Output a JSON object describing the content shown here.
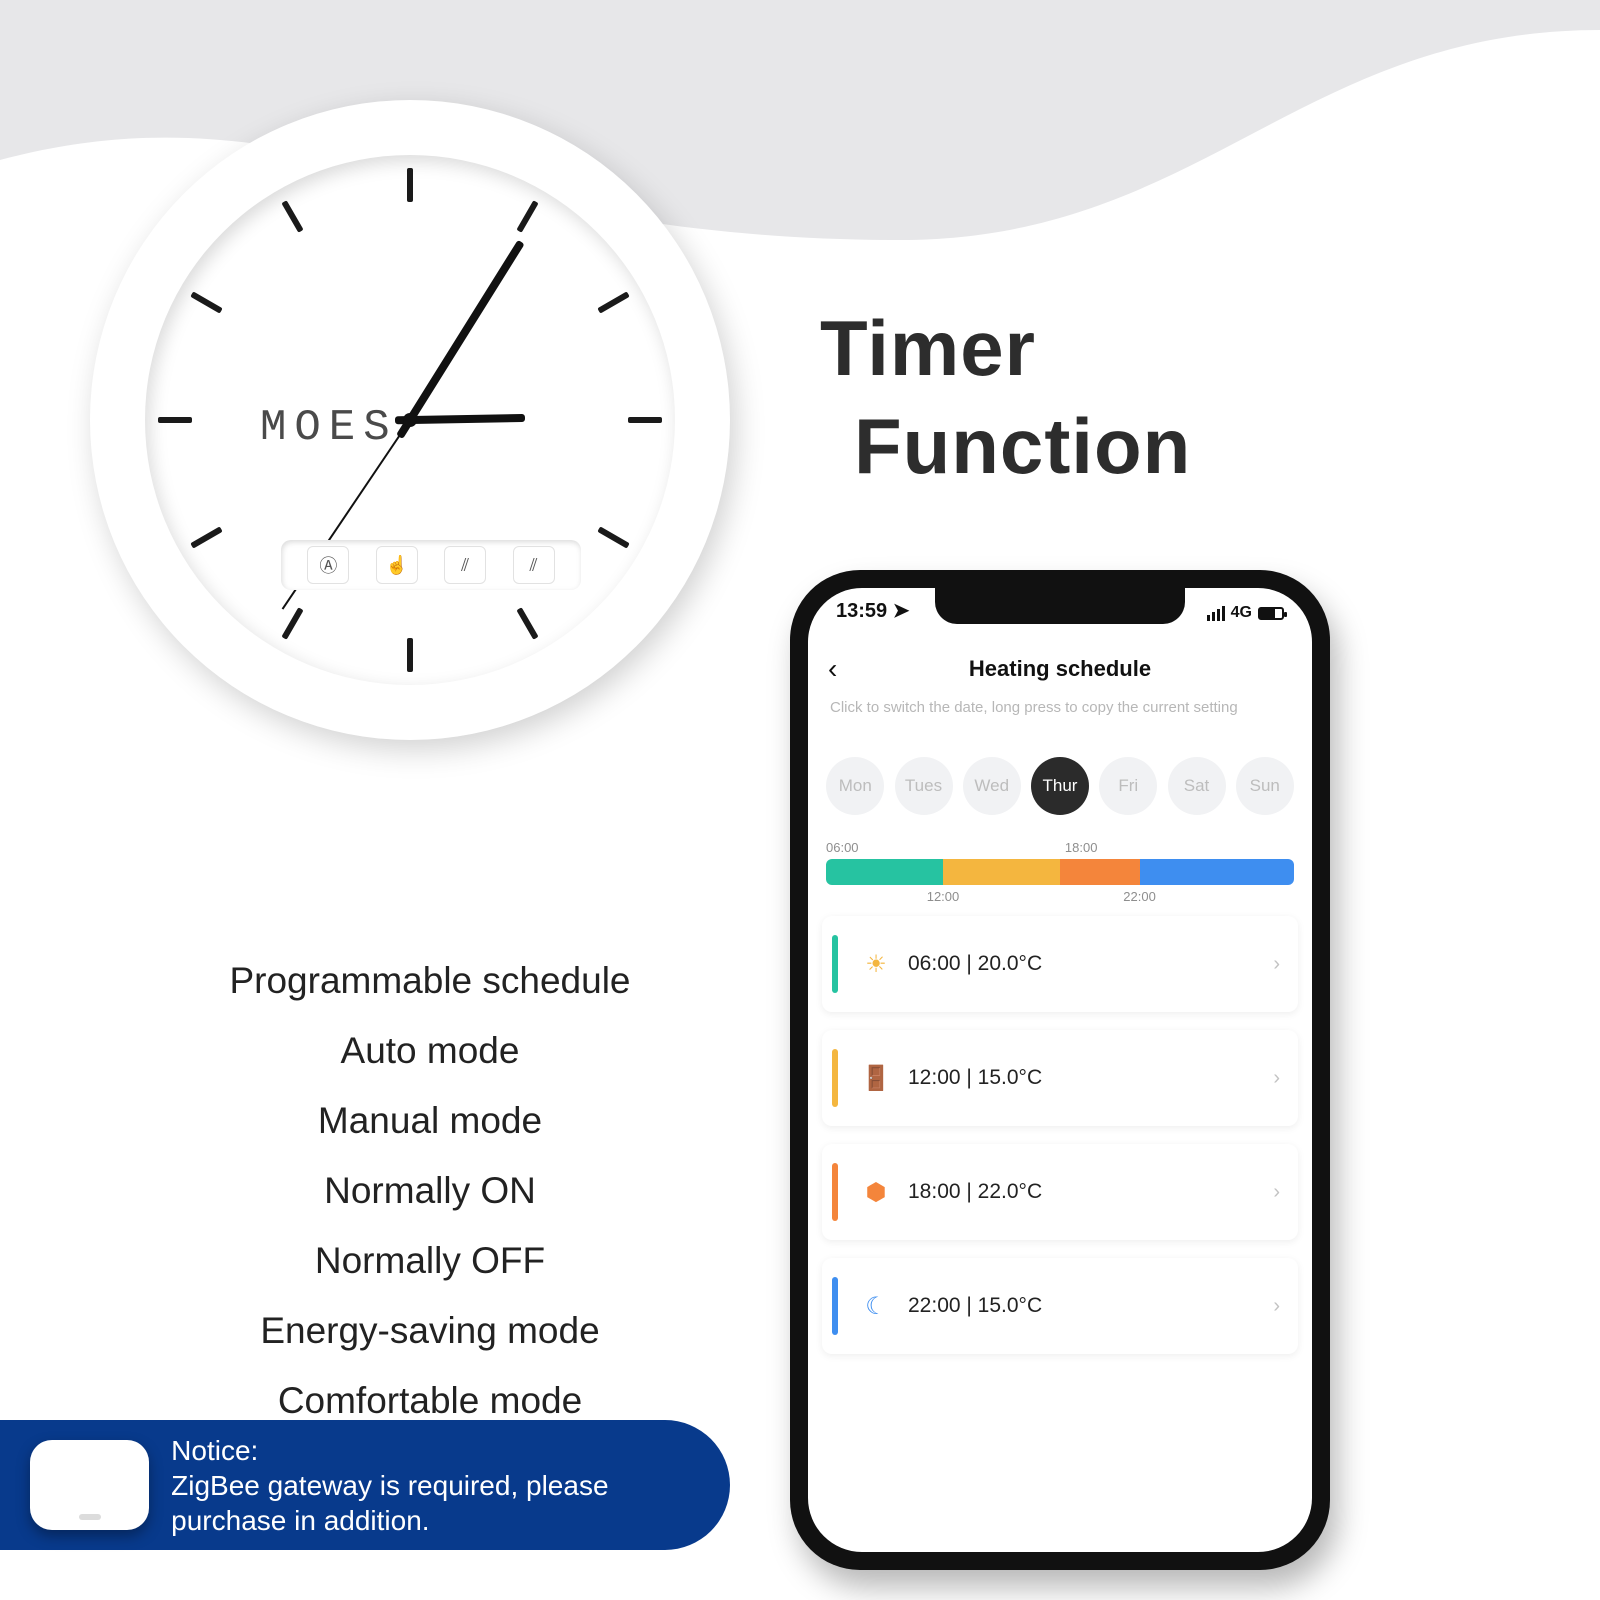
{
  "hero": {
    "line1": "Timer",
    "line2": "Function"
  },
  "clock": {
    "brand": "MOES"
  },
  "features": [
    "Programmable schedule",
    "Auto mode",
    "Manual mode",
    "Normally ON",
    "Normally OFF",
    "Energy-saving mode",
    "Comfortable mode"
  ],
  "notice": {
    "heading": "Notice:",
    "body": "ZigBee gateway is required, please purchase in addition."
  },
  "phone": {
    "status": {
      "time": "13:59",
      "network": "4G"
    },
    "title": "Heating schedule",
    "hint": "Click to switch the date, long press to copy the current setting",
    "days": [
      {
        "label": "Mon",
        "active": false
      },
      {
        "label": "Tues",
        "active": false
      },
      {
        "label": "Wed",
        "active": false
      },
      {
        "label": "Thur",
        "active": true
      },
      {
        "label": "Fri",
        "active": false
      },
      {
        "label": "Sat",
        "active": false
      },
      {
        "label": "Sun",
        "active": false
      }
    ],
    "timeline": {
      "top_left": "06:00",
      "top_right": "18:00",
      "bot_left": "12:00",
      "bot_right": "22:00",
      "segments": [
        {
          "color": "c-teal",
          "pct": 25
        },
        {
          "color": "c-amber",
          "pct": 25
        },
        {
          "color": "c-orange",
          "pct": 17
        },
        {
          "color": "c-blue",
          "pct": 33
        }
      ]
    },
    "rows": [
      {
        "stripe": "c-teal",
        "icon": "sun-icon",
        "icon_tone": "t-amber",
        "label": "06:00 | 20.0°C"
      },
      {
        "stripe": "c-amber",
        "icon": "door-icon",
        "icon_tone": "t-amber",
        "label": "12:00 | 15.0°C"
      },
      {
        "stripe": "c-orange",
        "icon": "home-icon",
        "icon_tone": "t-orange",
        "label": "18:00 | 22.0°C"
      },
      {
        "stripe": "c-blue",
        "icon": "moon-icon",
        "icon_tone": "t-blue",
        "label": "22:00 | 15.0°C"
      }
    ]
  }
}
